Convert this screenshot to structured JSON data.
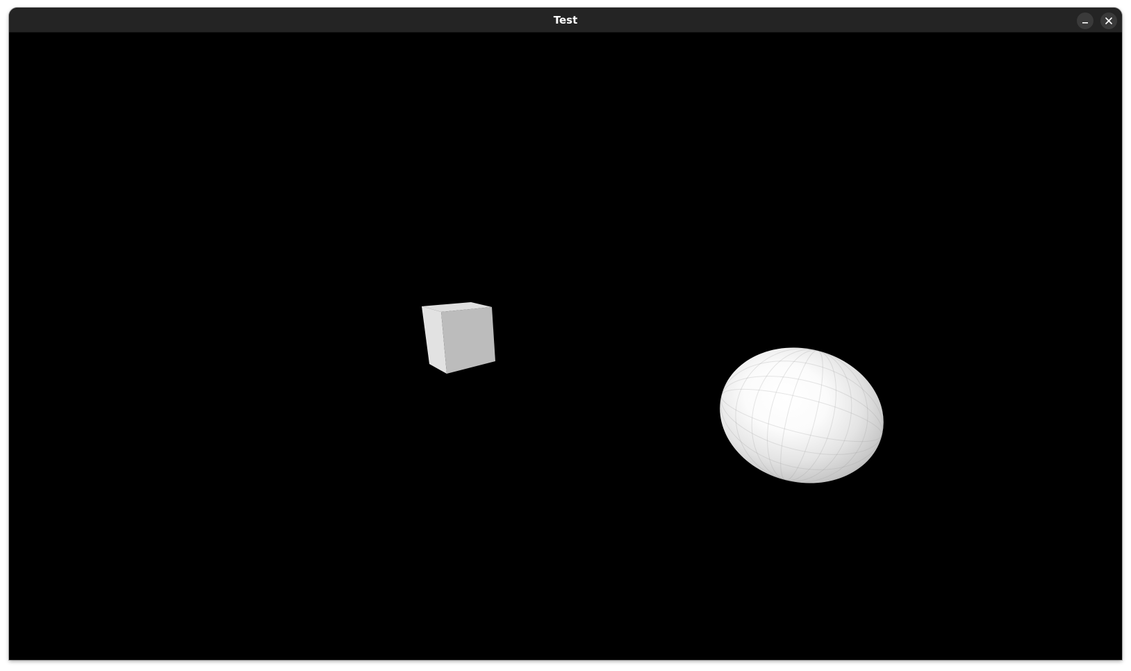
{
  "window": {
    "title": "Test",
    "controls": {
      "minimize_icon": "minimize-icon",
      "close_icon": "close-icon"
    }
  },
  "scene": {
    "background": "#000000",
    "objects": [
      {
        "name": "cube",
        "color": "#bdbdbd"
      },
      {
        "name": "ellipsoid",
        "color": "#e6e6e6"
      }
    ]
  }
}
